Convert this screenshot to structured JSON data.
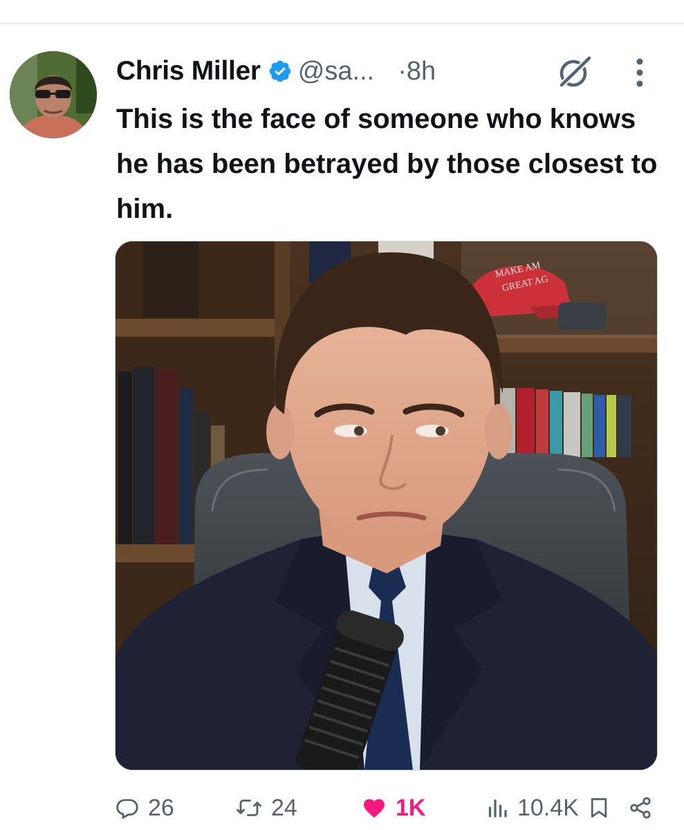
{
  "tweet": {
    "author": {
      "display_name": "Chris Miller",
      "handle": "@sa...",
      "avatar_icon": "user-avatar"
    },
    "separator": "·",
    "time": "8h",
    "text": "This is the face of someone who knows he has been betrayed by those closest to him.",
    "media": {
      "cap_text_line1": "MAKE AM",
      "cap_text_line2": "GREAT AG"
    },
    "actions": {
      "reply_count": "26",
      "repost_count": "24",
      "like_count": "1K",
      "view_count": "10.4K"
    }
  },
  "colors": {
    "verified": "#1d9bf0",
    "like": "#f91880",
    "secondary_text": "#536471",
    "divider": "#e7e9ee"
  },
  "icons": [
    "verified-badge-icon",
    "grok-icon",
    "more-options-icon",
    "reply-icon",
    "repost-icon",
    "like-icon",
    "views-icon",
    "bookmark-icon",
    "share-icon"
  ]
}
